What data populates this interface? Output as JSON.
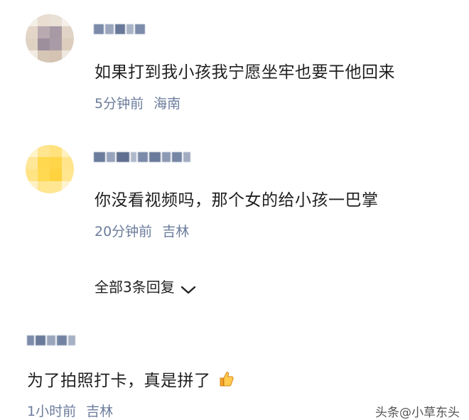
{
  "comments": [
    {
      "content": "如果打到我小孩我宁愿坐牢也要干他回来",
      "time": "5分钟前",
      "location": "海南"
    },
    {
      "content": "你没看视频吗，那个女的给小孩一巴掌",
      "time": "20分钟前",
      "location": "吉林"
    },
    {
      "content": "为了拍照打卡，真是拼了",
      "time": "1小时前",
      "location": "吉林"
    }
  ],
  "replies": {
    "label": "全部3条回复",
    "icon": "chevron-down-icon"
  },
  "emoji": {
    "icon": "thumbs-up-icon"
  },
  "watermark": {
    "text": "头条@小草东头"
  },
  "colors": {
    "meta": "#6b7c9c",
    "text": "#1f1f1f"
  }
}
